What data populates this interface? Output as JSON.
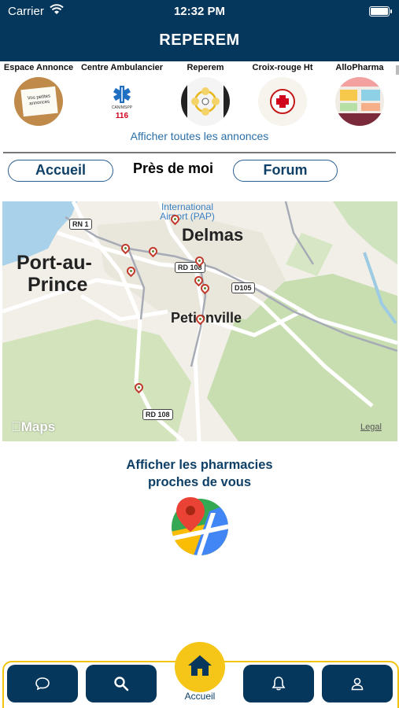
{
  "status_bar": {
    "carrier": "Carrier",
    "time": "12:32 PM"
  },
  "header": {
    "title": "REPEREM"
  },
  "partners": [
    {
      "label": "Espace Annonce",
      "thumb_text": "Vos petites annonces"
    },
    {
      "label": "Centre Ambulancier",
      "thumb_text": "CAN/MSPP",
      "thumb_number": "116"
    },
    {
      "label": "Reperem"
    },
    {
      "label": "Croix-rouge Ht"
    },
    {
      "label": "AlloPharma"
    }
  ],
  "show_all_link": "Afficher toutes les annonces",
  "tabs": {
    "home": "Accueil",
    "nearby": "Près de moi",
    "forum": "Forum"
  },
  "map": {
    "labels": {
      "airport": "International Airport (PAP)",
      "delmas": "Delmas",
      "port_au_prince_1": "Port-au-",
      "port_au_prince_2": "Prince",
      "petionville": "Petionville"
    },
    "road_shields": {
      "rn1": "RN 1",
      "rd108_a": "RD 108",
      "d105": "D105",
      "rd108_b": "RD 108"
    },
    "attribution": "Maps",
    "legal": "Legal"
  },
  "cta": {
    "line1": "Afficher les pharmacies",
    "line2": "proches de vous"
  },
  "bottom_nav": {
    "home_label": "Accueil"
  },
  "colors": {
    "navy": "#05365c",
    "accent_yellow": "#f5c518",
    "link_blue": "#2a6fa8"
  }
}
